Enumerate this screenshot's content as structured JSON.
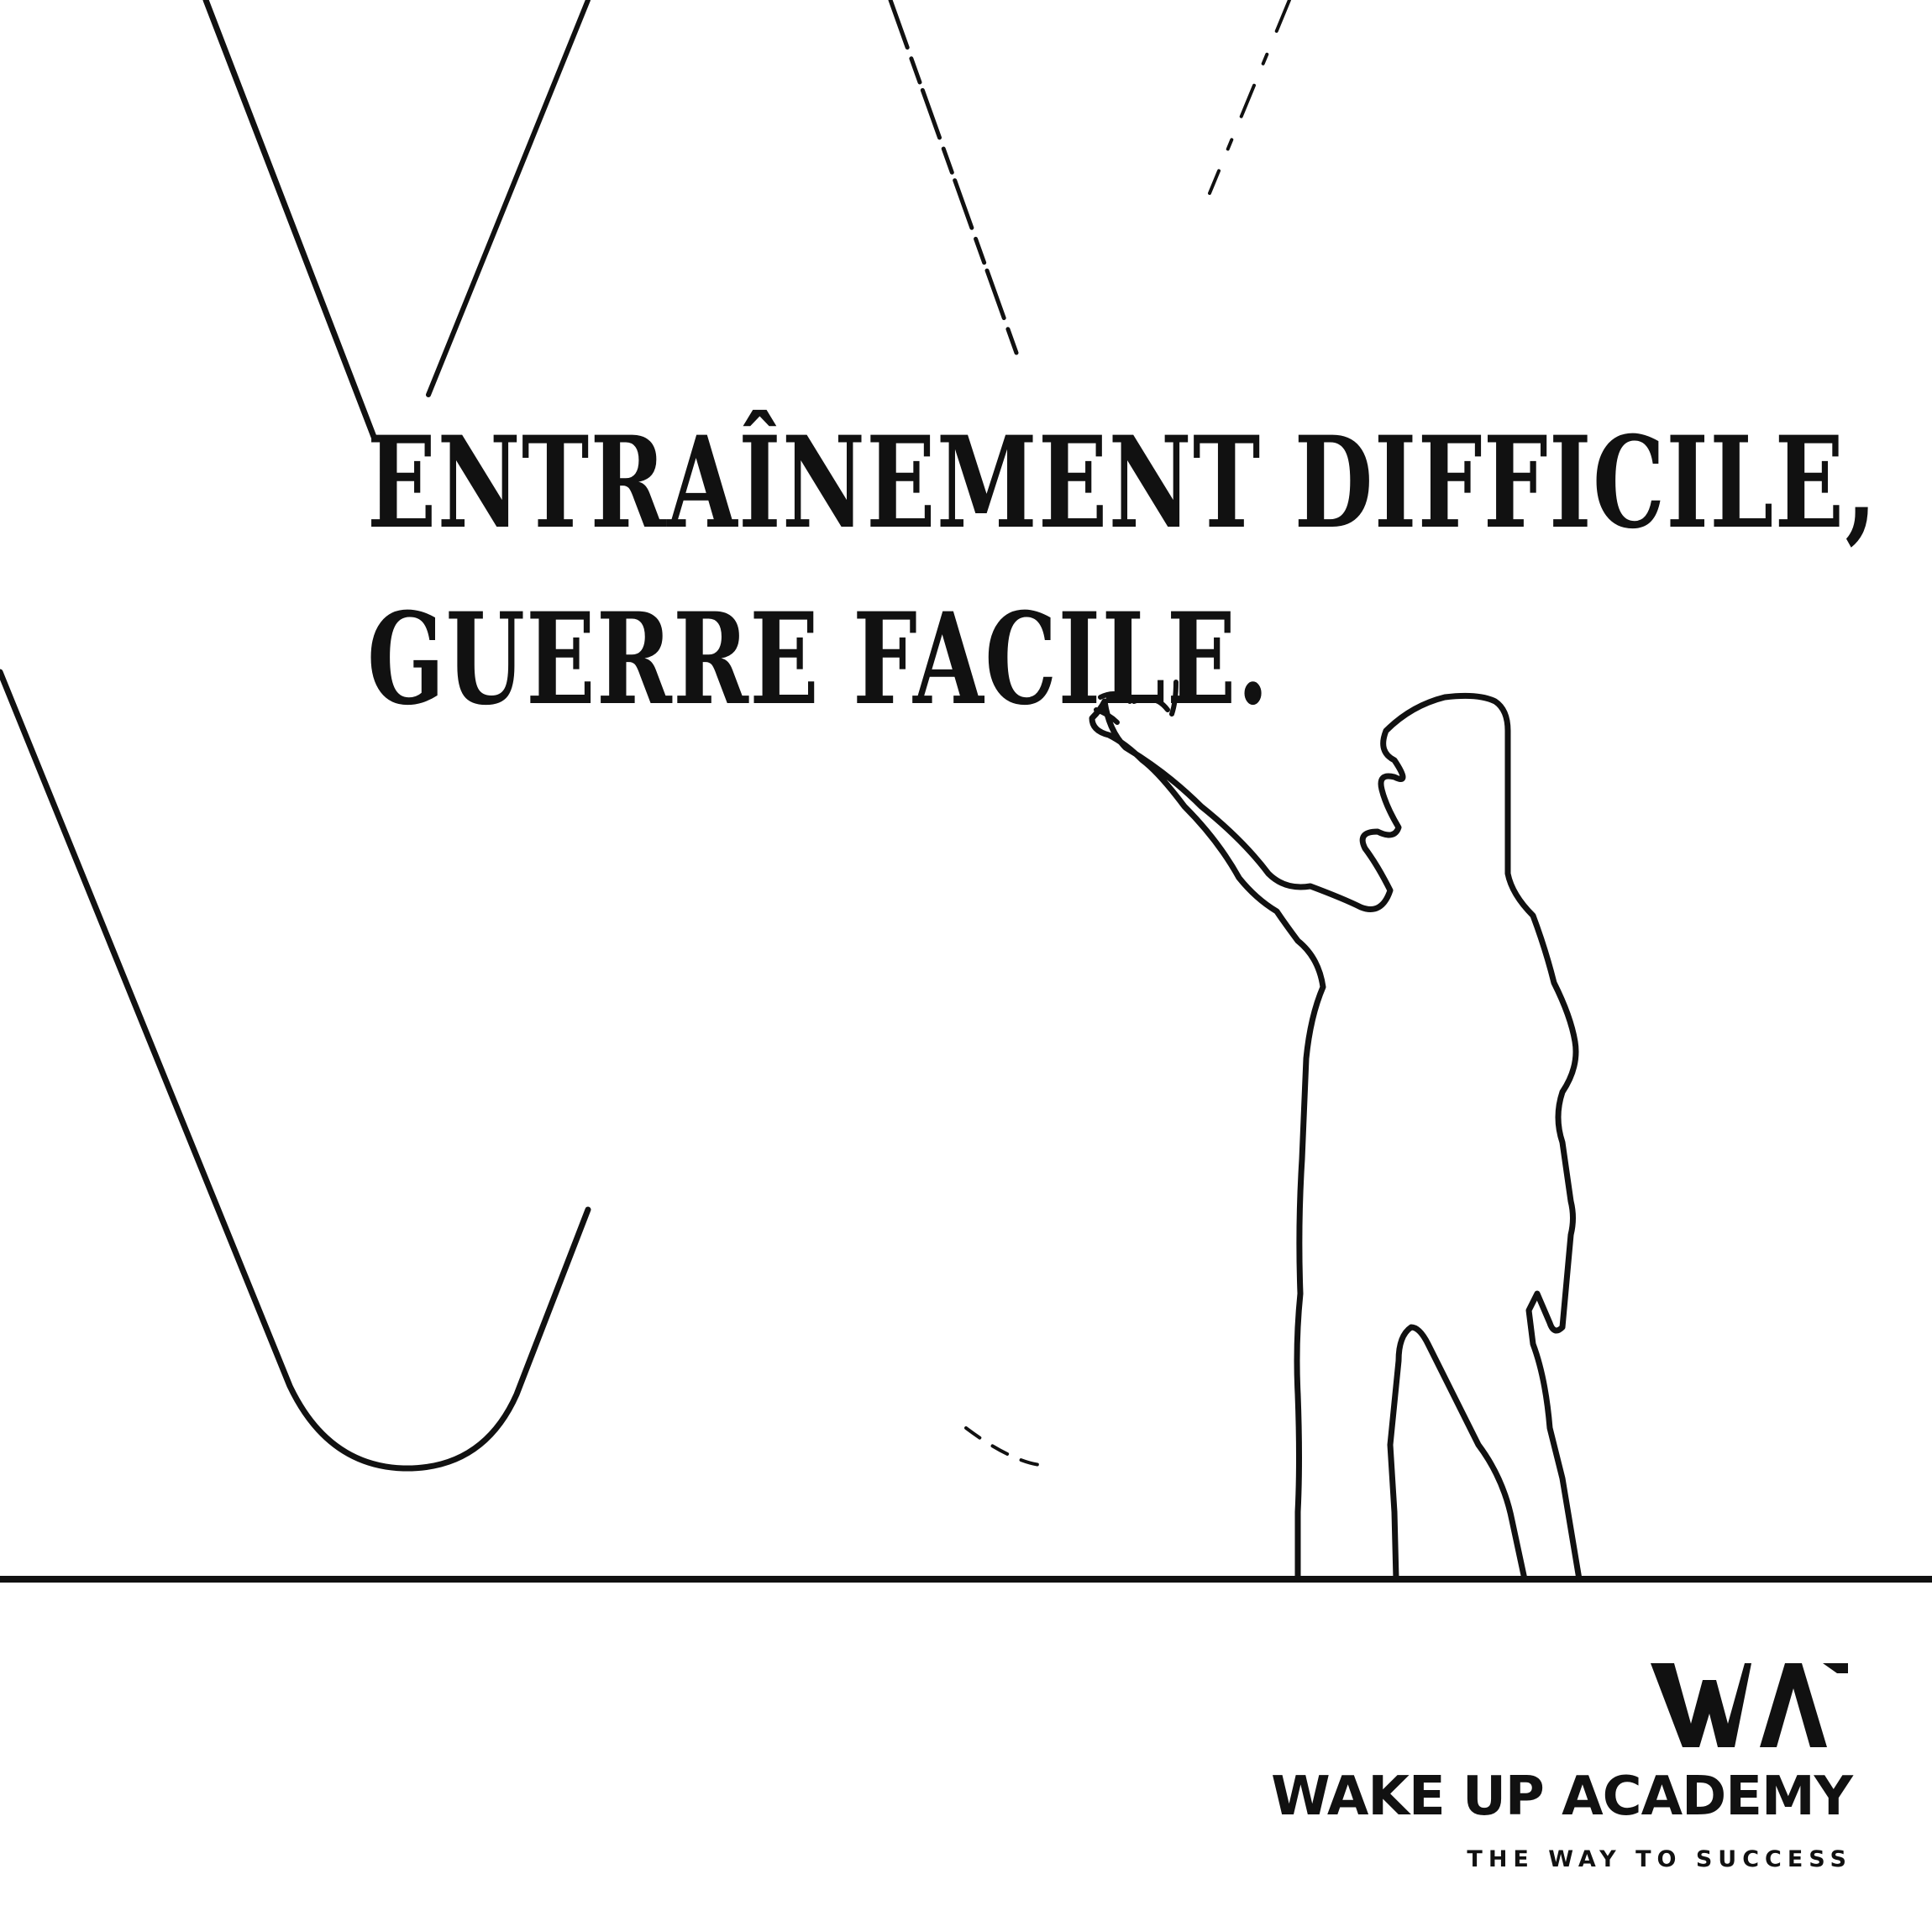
{
  "quote": {
    "line1": "ENTRAÎNEMENT DIFFICILE,",
    "line2": "GUERRE FACILE."
  },
  "brand": {
    "name": "WAKE UP ACADEMY",
    "tagline": "THE WAY TO SUCCESS",
    "logo_icon": "wa-monogram-logo"
  },
  "colors": {
    "ink": "#111111",
    "background": "#ffffff"
  }
}
